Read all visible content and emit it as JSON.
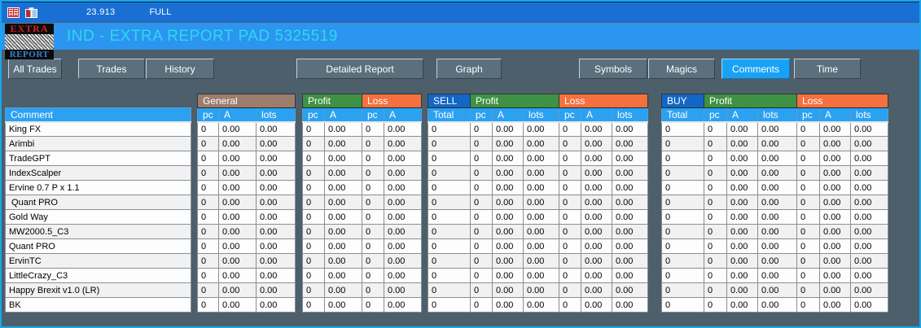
{
  "topbar": {
    "value": "23.913",
    "mode": "FULL",
    "icons": [
      "table-icon",
      "tiles-icon"
    ]
  },
  "title": "IND - EXTRA REPORT PAD 5325519",
  "logo": {
    "top": "EXTRA",
    "bottom": "REPORT"
  },
  "colors": {
    "topbar_blue": "#1a6fd4",
    "header_blue": "#2b95ef",
    "title_cyan": "#2fd8ef",
    "background_slate": "#4c5f6b",
    "column_header_blue": "#2ba1f2",
    "active_tab_blue": "#19a2f5",
    "group_general": "#9c7d6c",
    "group_profit": "#3f9143",
    "group_loss": "#f5703d",
    "group_sell_buy": "#1366c4",
    "value_green": "#0b7c0f"
  },
  "tabs": [
    {
      "label": "All Trades",
      "active": false
    },
    {
      "label": "Trades",
      "active": false
    },
    {
      "label": "History",
      "active": false
    },
    {
      "label": "Detailed Report",
      "active": false
    },
    {
      "label": "Graph",
      "active": false
    },
    {
      "label": "Symbols",
      "active": false
    },
    {
      "label": "Magics",
      "active": false
    },
    {
      "label": "Comments",
      "active": true
    },
    {
      "label": "Time",
      "active": false
    }
  ],
  "report": {
    "comment_column": {
      "header": "Comment"
    },
    "sections": [
      {
        "key": "general",
        "groups": [
          {
            "label": "General",
            "color": "#9c7d6c",
            "cols": 3
          }
        ],
        "columns": [
          "pc",
          "A",
          "lots"
        ],
        "green_columns": [
          1
        ]
      },
      {
        "key": "profit_loss",
        "groups": [
          {
            "label": "Profit",
            "color": "#3f9143",
            "cols": 2
          },
          {
            "label": "Loss",
            "color": "#f5703d",
            "cols": 2
          }
        ],
        "columns": [
          "pc",
          "A",
          "pc",
          "A"
        ],
        "green_columns": [
          1,
          3
        ]
      },
      {
        "key": "sell",
        "groups": [
          {
            "label": "SELL",
            "color": "#1366c4",
            "cols": 1
          },
          {
            "label": "Profit",
            "color": "#3f9143",
            "cols": 3
          },
          {
            "label": "Loss",
            "color": "#f5703d",
            "cols": 3
          }
        ],
        "columns": [
          "Total",
          "pc",
          "A",
          "lots",
          "pc",
          "A",
          "lots"
        ],
        "green_columns": [
          2,
          5
        ]
      },
      {
        "key": "buy",
        "groups": [
          {
            "label": "BUY",
            "color": "#1366c4",
            "cols": 1
          },
          {
            "label": "Profit",
            "color": "#3f9143",
            "cols": 3
          },
          {
            "label": "Loss",
            "color": "#f5703d",
            "cols": 3
          }
        ],
        "columns": [
          "Total",
          "pc",
          "A",
          "lots",
          "pc",
          "A",
          "lots"
        ],
        "green_columns": [
          2,
          5
        ]
      }
    ],
    "rows": [
      {
        "comment": "King FX",
        "general": [
          "0",
          "0.00",
          "0.00"
        ],
        "profit_loss": [
          "0",
          "0.00",
          "0",
          "0.00"
        ],
        "sell": [
          "0",
          "0",
          "0.00",
          "0.00",
          "0",
          "0.00",
          "0.00"
        ],
        "buy": [
          "0",
          "0",
          "0.00",
          "0.00",
          "0",
          "0.00",
          "0.00"
        ]
      },
      {
        "comment": "Arimbi",
        "general": [
          "0",
          "0.00",
          "0.00"
        ],
        "profit_loss": [
          "0",
          "0.00",
          "0",
          "0.00"
        ],
        "sell": [
          "0",
          "0",
          "0.00",
          "0.00",
          "0",
          "0.00",
          "0.00"
        ],
        "buy": [
          "0",
          "0",
          "0.00",
          "0.00",
          "0",
          "0.00",
          "0.00"
        ]
      },
      {
        "comment": "TradeGPT",
        "general": [
          "0",
          "0.00",
          "0.00"
        ],
        "profit_loss": [
          "0",
          "0.00",
          "0",
          "0.00"
        ],
        "sell": [
          "0",
          "0",
          "0.00",
          "0.00",
          "0",
          "0.00",
          "0.00"
        ],
        "buy": [
          "0",
          "0",
          "0.00",
          "0.00",
          "0",
          "0.00",
          "0.00"
        ]
      },
      {
        "comment": "IndexScalper",
        "general": [
          "0",
          "0.00",
          "0.00"
        ],
        "profit_loss": [
          "0",
          "0.00",
          "0",
          "0.00"
        ],
        "sell": [
          "0",
          "0",
          "0.00",
          "0.00",
          "0",
          "0.00",
          "0.00"
        ],
        "buy": [
          "0",
          "0",
          "0.00",
          "0.00",
          "0",
          "0.00",
          "0.00"
        ]
      },
      {
        "comment": "Ervine 0.7 P x 1.1",
        "general": [
          "0",
          "0.00",
          "0.00"
        ],
        "profit_loss": [
          "0",
          "0.00",
          "0",
          "0.00"
        ],
        "sell": [
          "0",
          "0",
          "0.00",
          "0.00",
          "0",
          "0.00",
          "0.00"
        ],
        "buy": [
          "0",
          "0",
          "0.00",
          "0.00",
          "0",
          "0.00",
          "0.00"
        ]
      },
      {
        "comment": " Quant PRO",
        "general": [
          "0",
          "0.00",
          "0.00"
        ],
        "profit_loss": [
          "0",
          "0.00",
          "0",
          "0.00"
        ],
        "sell": [
          "0",
          "0",
          "0.00",
          "0.00",
          "0",
          "0.00",
          "0.00"
        ],
        "buy": [
          "0",
          "0",
          "0.00",
          "0.00",
          "0",
          "0.00",
          "0.00"
        ]
      },
      {
        "comment": "Gold Way",
        "general": [
          "0",
          "0.00",
          "0.00"
        ],
        "profit_loss": [
          "0",
          "0.00",
          "0",
          "0.00"
        ],
        "sell": [
          "0",
          "0",
          "0.00",
          "0.00",
          "0",
          "0.00",
          "0.00"
        ],
        "buy": [
          "0",
          "0",
          "0.00",
          "0.00",
          "0",
          "0.00",
          "0.00"
        ]
      },
      {
        "comment": "MW2000.5_C3",
        "general": [
          "0",
          "0.00",
          "0.00"
        ],
        "profit_loss": [
          "0",
          "0.00",
          "0",
          "0.00"
        ],
        "sell": [
          "0",
          "0",
          "0.00",
          "0.00",
          "0",
          "0.00",
          "0.00"
        ],
        "buy": [
          "0",
          "0",
          "0.00",
          "0.00",
          "0",
          "0.00",
          "0.00"
        ]
      },
      {
        "comment": "Quant PRO",
        "general": [
          "0",
          "0.00",
          "0.00"
        ],
        "profit_loss": [
          "0",
          "0.00",
          "0",
          "0.00"
        ],
        "sell": [
          "0",
          "0",
          "0.00",
          "0.00",
          "0",
          "0.00",
          "0.00"
        ],
        "buy": [
          "0",
          "0",
          "0.00",
          "0.00",
          "0",
          "0.00",
          "0.00"
        ]
      },
      {
        "comment": "ErvinTC",
        "general": [
          "0",
          "0.00",
          "0.00"
        ],
        "profit_loss": [
          "0",
          "0.00",
          "0",
          "0.00"
        ],
        "sell": [
          "0",
          "0",
          "0.00",
          "0.00",
          "0",
          "0.00",
          "0.00"
        ],
        "buy": [
          "0",
          "0",
          "0.00",
          "0.00",
          "0",
          "0.00",
          "0.00"
        ]
      },
      {
        "comment": "LittleCrazy_C3",
        "general": [
          "0",
          "0.00",
          "0.00"
        ],
        "profit_loss": [
          "0",
          "0.00",
          "0",
          "0.00"
        ],
        "sell": [
          "0",
          "0",
          "0.00",
          "0.00",
          "0",
          "0.00",
          "0.00"
        ],
        "buy": [
          "0",
          "0",
          "0.00",
          "0.00",
          "0",
          "0.00",
          "0.00"
        ]
      },
      {
        "comment": "Happy Brexit v1.0 (LR)",
        "general": [
          "0",
          "0.00",
          "0.00"
        ],
        "profit_loss": [
          "0",
          "0.00",
          "0",
          "0.00"
        ],
        "sell": [
          "0",
          "0",
          "0.00",
          "0.00",
          "0",
          "0.00",
          "0.00"
        ],
        "buy": [
          "0",
          "0",
          "0.00",
          "0.00",
          "0",
          "0.00",
          "0.00"
        ]
      },
      {
        "comment": "BK",
        "general": [
          "0",
          "0.00",
          "0.00"
        ],
        "profit_loss": [
          "0",
          "0.00",
          "0",
          "0.00"
        ],
        "sell": [
          "0",
          "0",
          "0.00",
          "0.00",
          "0",
          "0.00",
          "0.00"
        ],
        "buy": [
          "0",
          "0",
          "0.00",
          "0.00",
          "0",
          "0.00",
          "0.00"
        ]
      }
    ]
  }
}
